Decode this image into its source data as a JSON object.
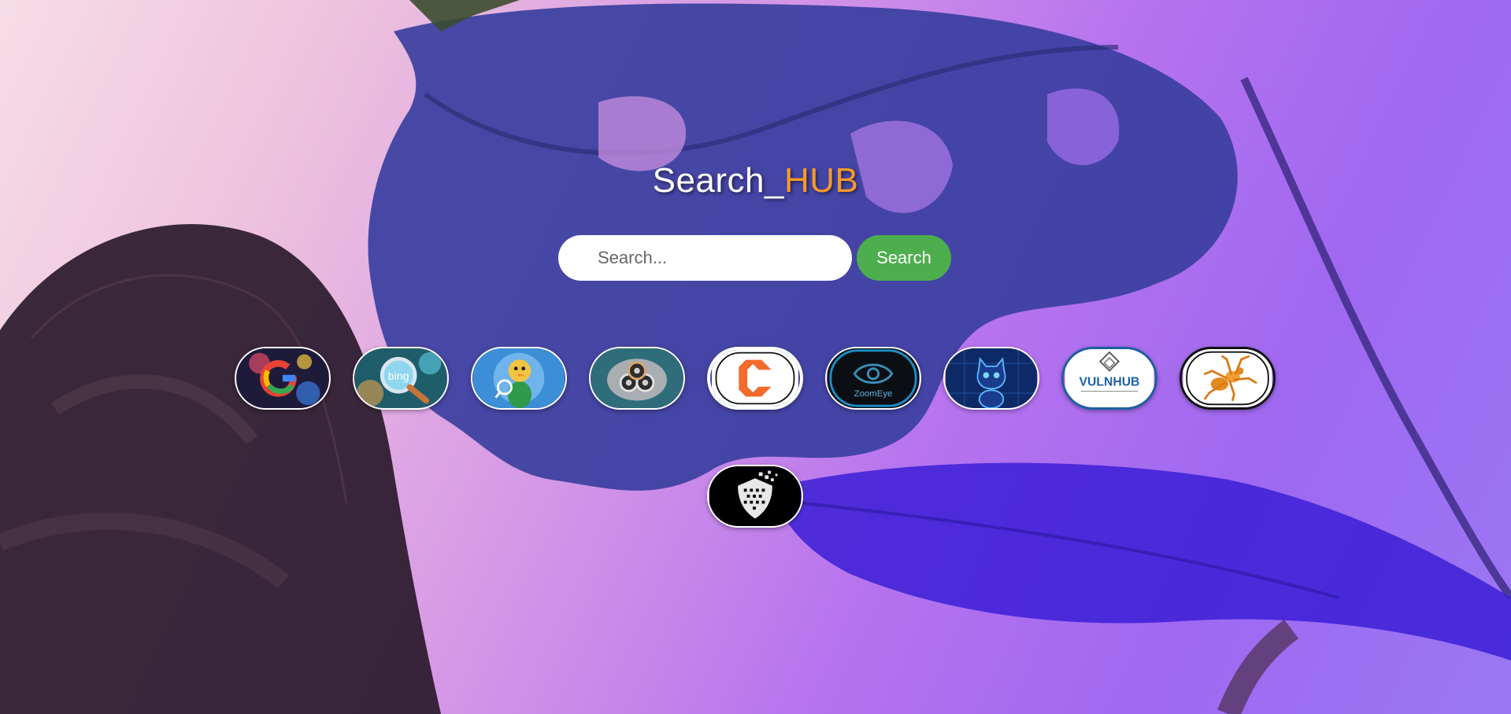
{
  "header": {
    "title_main": "Search_",
    "title_accent": "HUB",
    "accent_color": "#f59b26"
  },
  "search": {
    "placeholder": "Search...",
    "value": "",
    "button_label": "Search",
    "button_color": "#4cae4c"
  },
  "engines": [
    {
      "name": "google-icon"
    },
    {
      "name": "bing-icon",
      "label": "bing"
    },
    {
      "name": "duckduckgo-icon"
    },
    {
      "name": "search-engine-icon"
    },
    {
      "name": "censys-icon"
    },
    {
      "name": "zoomeye-icon",
      "label": "ZoomEye"
    },
    {
      "name": "github-icon"
    },
    {
      "name": "vulnhub-icon",
      "label": "VULNHUB"
    },
    {
      "name": "spider-icon"
    },
    {
      "name": "shield-icon"
    }
  ]
}
